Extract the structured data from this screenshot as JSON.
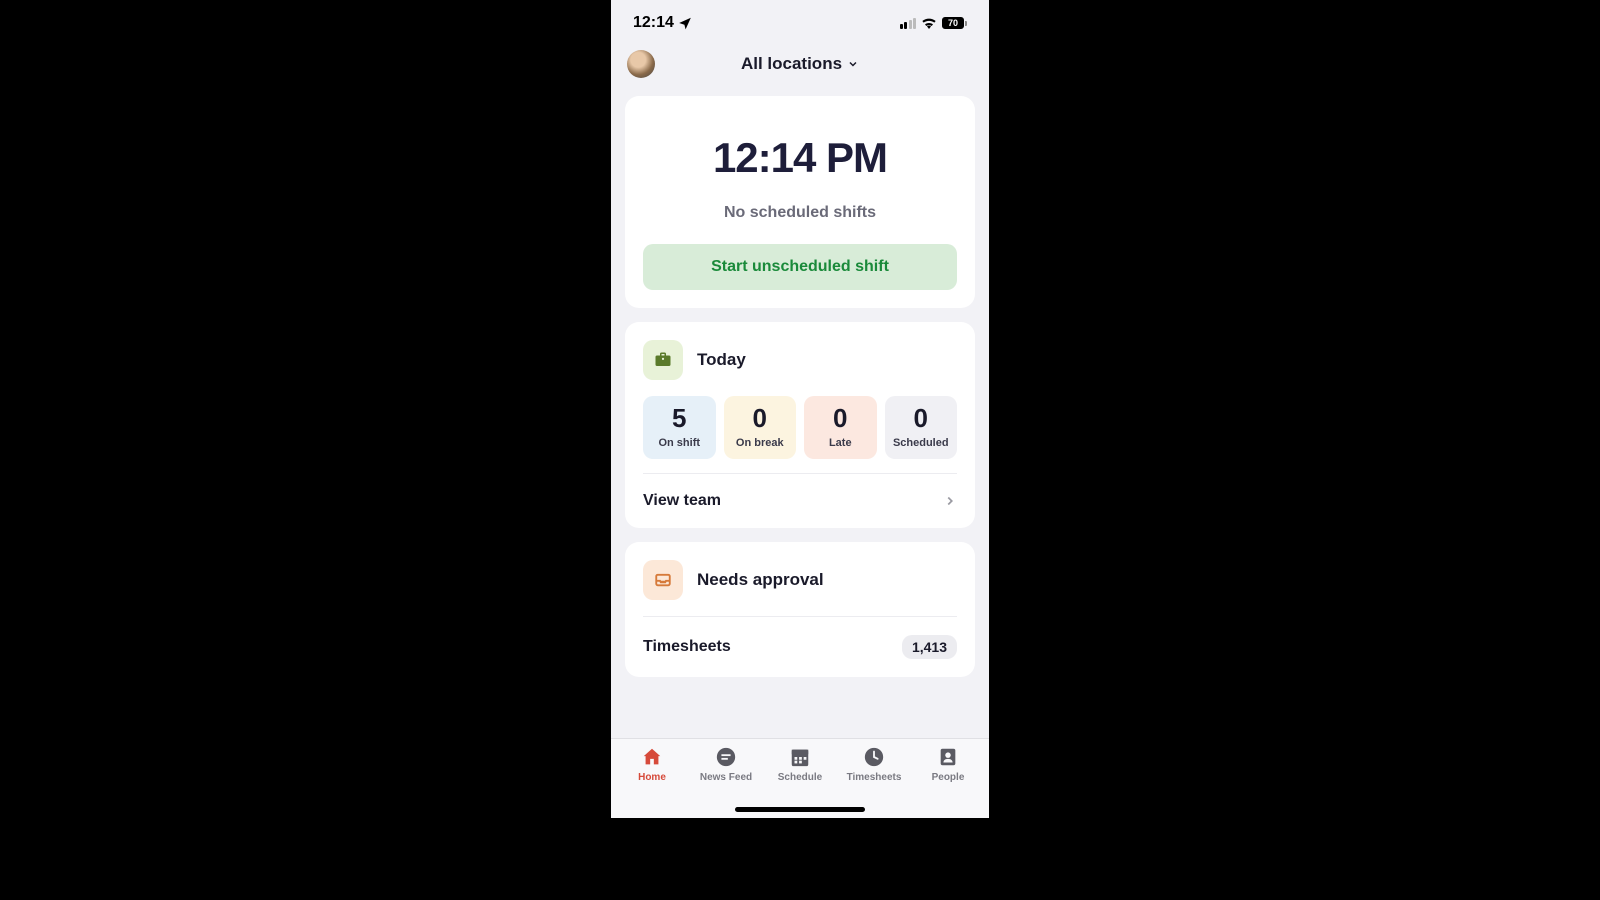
{
  "status_bar": {
    "time": "12:14",
    "battery": "70"
  },
  "header": {
    "location_label": "All locations"
  },
  "clock_card": {
    "time": "12:14 PM",
    "status": "No scheduled shifts",
    "button_label": "Start unscheduled shift"
  },
  "today": {
    "title": "Today",
    "stats": {
      "on_shift": {
        "value": "5",
        "label": "On shift"
      },
      "on_break": {
        "value": "0",
        "label": "On break"
      },
      "late": {
        "value": "0",
        "label": "Late"
      },
      "scheduled": {
        "value": "0",
        "label": "Scheduled"
      }
    },
    "view_team": "View team"
  },
  "approval": {
    "title": "Needs approval",
    "timesheets_label": "Timesheets",
    "timesheets_count": "1,413"
  },
  "tabs": {
    "home": "Home",
    "news_feed": "News Feed",
    "schedule": "Schedule",
    "timesheets": "Timesheets",
    "people": "People"
  }
}
